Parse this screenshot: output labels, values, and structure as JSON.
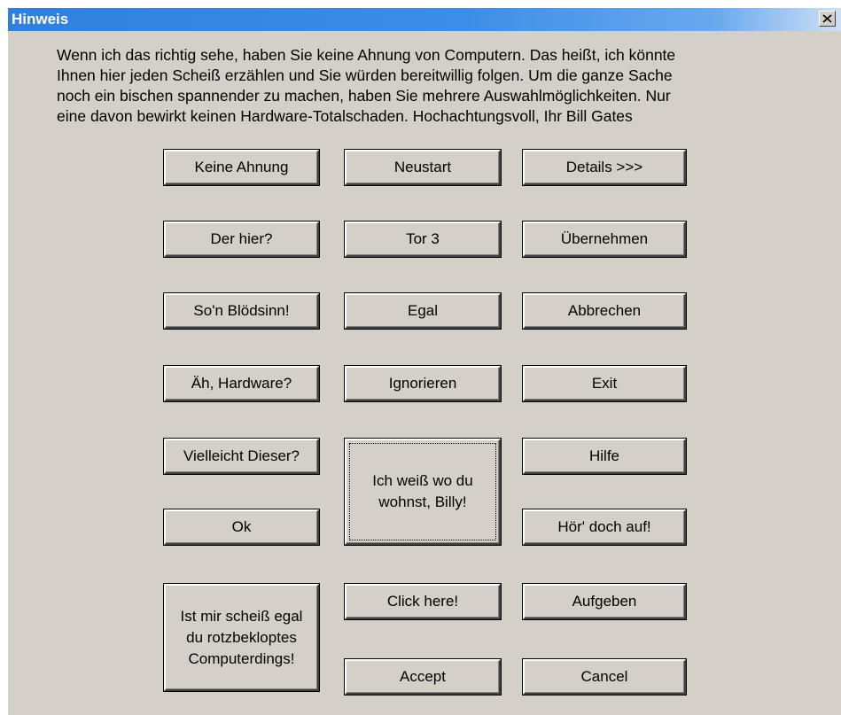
{
  "dialog": {
    "title": "Hinweis",
    "close_glyph": "close-icon",
    "message_lines": [
      "Wenn ich das richtig sehe, haben Sie keine Ahnung von Computern. Das heißt, ich könnte",
      "Ihnen hier jeden Scheiß erzählen und Sie würden bereitwillig folgen. Um die ganze Sache",
      "noch ein bischen spannender zu machen, haben Sie mehrere Auswahlmöglichkeiten. Nur",
      "eine davon bewirkt keinen Hardware-Totalschaden. Hochachtungsvoll, Ihr Bill Gates"
    ]
  },
  "buttons": {
    "keine_ahnung": "Keine Ahnung",
    "neustart": "Neustart",
    "details": "Details >>>",
    "der_hier": "Der hier?",
    "tor3": "Tor 3",
    "uebernehmen": "Übernehmen",
    "blodsinn": "So'n Blödsinn!",
    "egal": "Egal",
    "abbrechen": "Abbrechen",
    "hardware": "Äh, Hardware?",
    "ignorieren": "Ignorieren",
    "exit": "Exit",
    "vielleicht": "Vielleicht Dieser?",
    "billy_line1": "Ich weiß wo du",
    "billy_line2": "wohnst, Billy!",
    "hilfe": "Hilfe",
    "ok": "Ok",
    "hoer_auf": "Hör' doch auf!",
    "egal_big_line1": "Ist mir scheiß egal",
    "egal_big_line2": "du rotzbekloptes",
    "egal_big_line3": "Computerdings!",
    "click_here": "Click here!",
    "aufgeben": "Aufgeben",
    "accept": "Accept",
    "cancel": "Cancel"
  }
}
